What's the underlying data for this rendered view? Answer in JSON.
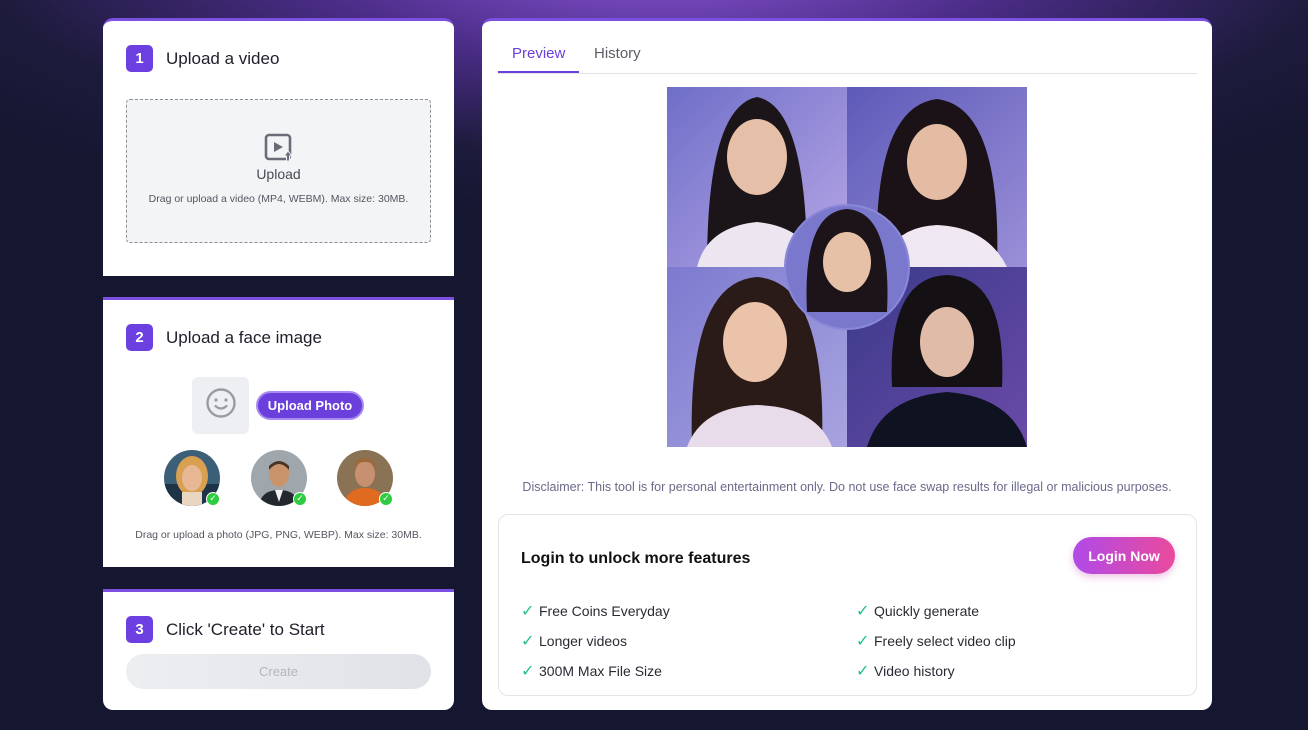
{
  "steps": [
    {
      "num": "1",
      "title": "Upload a video"
    },
    {
      "num": "2",
      "title": "Upload a face image"
    },
    {
      "num": "3",
      "title": "Click 'Create' to Start"
    }
  ],
  "video_upload": {
    "label": "Upload",
    "hint": "Drag or upload a video (MP4, WEBM). Max size: 30MB.",
    "icon": "video-upload-icon"
  },
  "face_upload": {
    "button": "Upload Photo",
    "hint": "Drag or upload a photo (JPG, PNG, WEBP). Max size: 30MB.",
    "icon": "face-icon",
    "samples": [
      "sample-face-1",
      "sample-face-2",
      "sample-face-3"
    ]
  },
  "create": {
    "label": "Create"
  },
  "tabs": [
    {
      "label": "Preview",
      "active": true
    },
    {
      "label": "History",
      "active": false
    }
  ],
  "disclaimer": "Disclaimer: This tool is for personal entertainment only. Do not use face swap results for illegal or malicious purposes.",
  "login": {
    "title": "Login to unlock more features",
    "button": "Login Now",
    "features_left": [
      "Free Coins Everyday",
      "Longer videos",
      "300M Max File Size"
    ],
    "features_right": [
      "Quickly generate",
      "Freely select video clip",
      "Video history"
    ]
  },
  "colors": {
    "accent": "#6a3fdc",
    "login_gradient_start": "#b04ae8",
    "login_gradient_end": "#ea4a9c",
    "check_green": "#22c08a"
  }
}
